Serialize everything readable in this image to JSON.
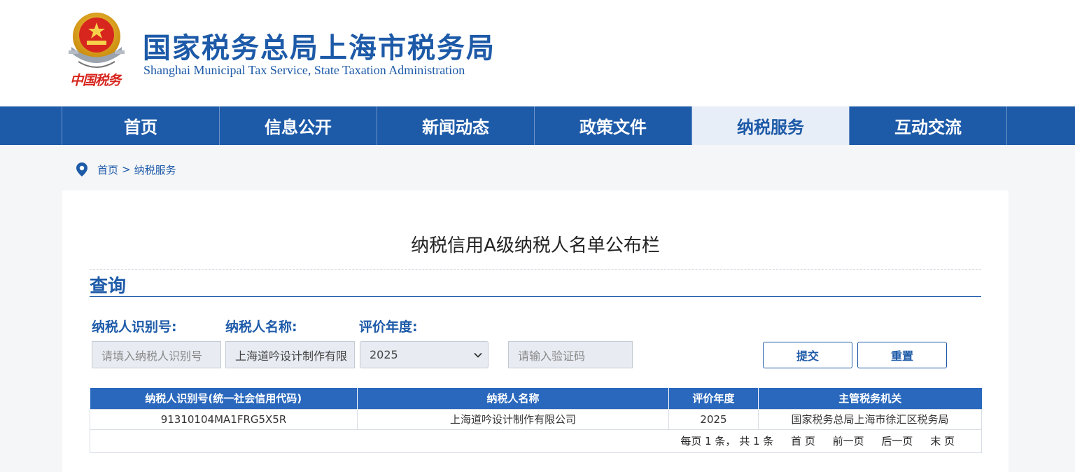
{
  "header": {
    "title_cn": "国家税务总局上海市税务局",
    "title_en": "Shanghai Municipal Tax Service, State Taxation Administration",
    "emblem_icon": "tax-emblem-icon",
    "emblem_caption": "中国税务"
  },
  "nav": {
    "items": [
      {
        "label": "首页"
      },
      {
        "label": "信息公开"
      },
      {
        "label": "新闻动态"
      },
      {
        "label": "政策文件"
      },
      {
        "label": "纳税服务",
        "active": true
      },
      {
        "label": "互动交流"
      }
    ]
  },
  "breadcrumb": {
    "icon": "location-pin-icon",
    "home": "首页",
    "separator": ">",
    "current": "纳税服务"
  },
  "main": {
    "heading": "纳税信用A级纳税人名单公布栏",
    "section_title": "查询",
    "form": {
      "taxpayer_id_label": "纳税人识别号:",
      "taxpayer_id_placeholder": "请填入纳税人识别号",
      "taxpayer_id_value": "",
      "taxpayer_name_label": "纳税人名称:",
      "taxpayer_name_value": "上海道吟设计制作有限",
      "year_label": "评价年度:",
      "year_value": "2025",
      "captcha_placeholder": "请输入验证码",
      "captcha_value": "",
      "submit_label": "提交",
      "reset_label": "重置"
    },
    "table": {
      "headers": [
        "纳税人识别号(统一社会信用代码)",
        "纳税人名称",
        "评价年度",
        "主管税务机关"
      ],
      "rows": [
        [
          "91310104MA1FRG5X5R",
          "上海道吟设计制作有限公司",
          "2025",
          "国家税务总局上海市徐汇区税务局"
        ]
      ]
    },
    "pager": {
      "info": "每页 1 条， 共 1 条",
      "first": "首 页",
      "prev": "前一页",
      "next": "后一页",
      "last": "末 页"
    }
  },
  "colors": {
    "brand_blue": "#1d5aa8",
    "table_header": "#2968bd",
    "nav_active_bg": "#e8eef7"
  }
}
